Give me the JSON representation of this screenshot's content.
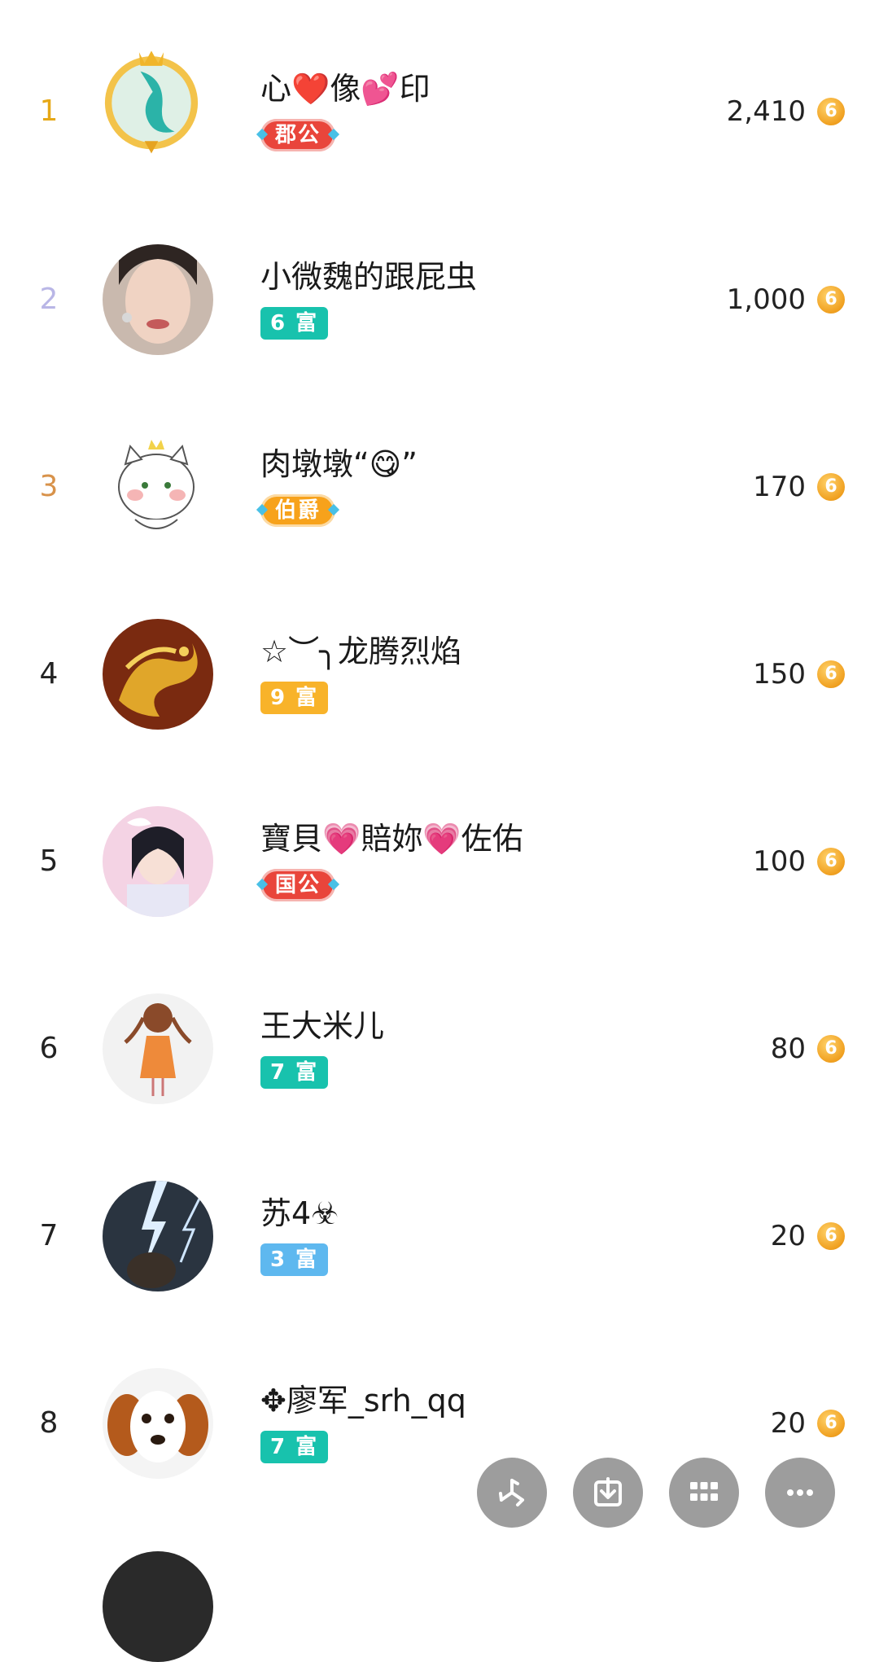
{
  "colors": {
    "rank_gold": "#e6a817",
    "rank_silver": "#b9b6e6",
    "rank_bronze": "#d8924a",
    "badge_red": "#e9453b",
    "badge_teal": "#18c2ad",
    "badge_orange": "#f7a21b",
    "badge_amber": "#f8b32a",
    "badge_blue": "#5eb8ef",
    "fab_gray": "#9d9d9d"
  },
  "rows": [
    {
      "rank": "1",
      "name": "心❤️像💕印",
      "badge": "郡公",
      "badge_color": "#e9453b",
      "badge_style": "noble",
      "rank_color": "#e6a817",
      "score": "2,410",
      "coin": "6",
      "avatar": "dragon-frame-avatar"
    },
    {
      "rank": "2",
      "name": "小微魏的跟屁虫",
      "badge": "6 富",
      "badge_color": "#18c2ad",
      "badge_style": "plain",
      "rank_color": "#b9b6e6",
      "score": "1,000",
      "coin": "6",
      "avatar": "woman-portrait-avatar"
    },
    {
      "rank": "3",
      "name": "肉墩墩“😋”",
      "badge": "伯爵",
      "badge_color": "#f7a21b",
      "badge_style": "noble",
      "rank_color": "#d8924a",
      "score": "170",
      "coin": "6",
      "avatar": "cat-cartoon-avatar"
    },
    {
      "rank": "4",
      "name": "☆︶╮龙腾烈焰",
      "badge": "9 富",
      "badge_color": "#f8b32a",
      "badge_style": "plain",
      "rank_color": "#222222",
      "score": "150",
      "coin": "6",
      "avatar": "golden-dragon-avatar"
    },
    {
      "rank": "5",
      "name": "寶貝💗賠妳💗佐佑",
      "badge": "国公",
      "badge_color": "#e9453b",
      "badge_style": "noble",
      "rank_color": "#222222",
      "score": "100",
      "coin": "6",
      "avatar": "girl-pink-avatar"
    },
    {
      "rank": "6",
      "name": "王大米儿",
      "badge": "7 富",
      "badge_color": "#18c2ad",
      "badge_style": "plain",
      "rank_color": "#222222",
      "score": "80",
      "coin": "6",
      "avatar": "doll-girl-avatar"
    },
    {
      "rank": "7",
      "name": "苏4☣",
      "badge": "3 富",
      "badge_color": "#5eb8ef",
      "badge_style": "plain",
      "rank_color": "#222222",
      "score": "20",
      "coin": "6",
      "avatar": "lightning-avatar"
    },
    {
      "rank": "8",
      "name": "✥廖军_srh_qq",
      "badge": "7 富",
      "badge_color": "#18c2ad",
      "badge_style": "plain",
      "rank_color": "#222222",
      "score": "20",
      "coin": "6",
      "avatar": "puppy-avatar"
    }
  ],
  "fab_buttons": [
    {
      "icon": "pinwheel-icon"
    },
    {
      "icon": "download-icon"
    },
    {
      "icon": "grid-icon"
    },
    {
      "icon": "more-icon"
    }
  ]
}
